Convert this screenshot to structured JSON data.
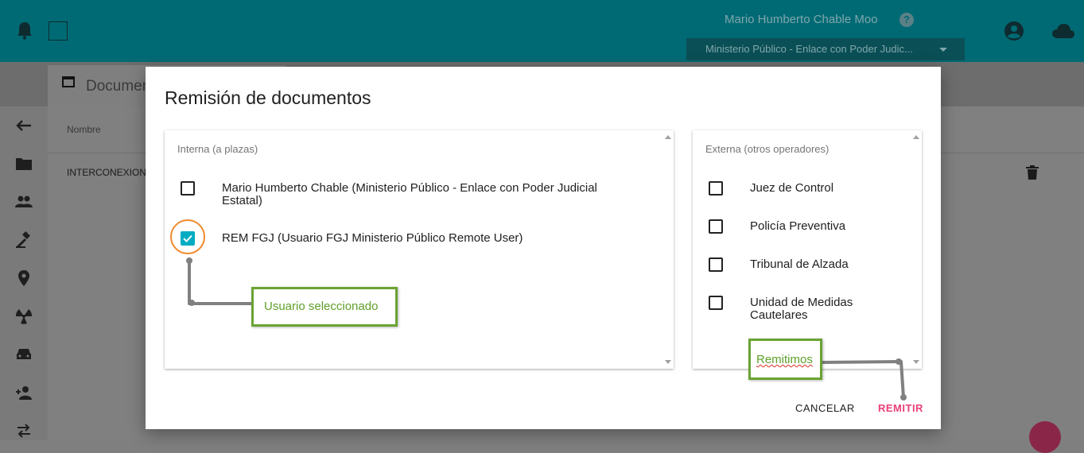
{
  "header": {
    "user_name": "Mario Humberto Chable Moo",
    "help_glyph": "?",
    "role_selector": "Ministerio Público - Enlace con Poder Judic..."
  },
  "tab": {
    "label": "Documentos"
  },
  "table": {
    "column_name": "Nombre",
    "rows": [
      "INTERCONEXION"
    ]
  },
  "dialog": {
    "title": "Remisión de documentos",
    "internal": {
      "title": "Interna (a plazas)",
      "items": [
        {
          "label": "Mario Humberto Chable (Ministerio Público - Enlace con Poder Judicial Estatal)",
          "checked": false
        },
        {
          "label": "REM FGJ (Usuario FGJ Ministerio Público Remote User)",
          "checked": true
        }
      ]
    },
    "external": {
      "title": "Externa (otros operadores)",
      "items": [
        {
          "label": "Juez de Control",
          "checked": false
        },
        {
          "label": "Policía Preventiva",
          "checked": false
        },
        {
          "label": "Tribunal de Alzada",
          "checked": false
        },
        {
          "label": "Unidad de Medidas Cautelares",
          "checked": false
        }
      ]
    },
    "cancel_label": "CANCELAR",
    "submit_label": "REMITIR"
  },
  "annotations": {
    "selected_user": "Usuario seleccionado",
    "submit_hint": "Remitimos"
  },
  "colors": {
    "topbar": "#006a74",
    "accent_checkbox": "#00acc1",
    "submit": "#e9407a",
    "callout_border": "#6aa333",
    "highlight_ring": "#f08a2c"
  }
}
